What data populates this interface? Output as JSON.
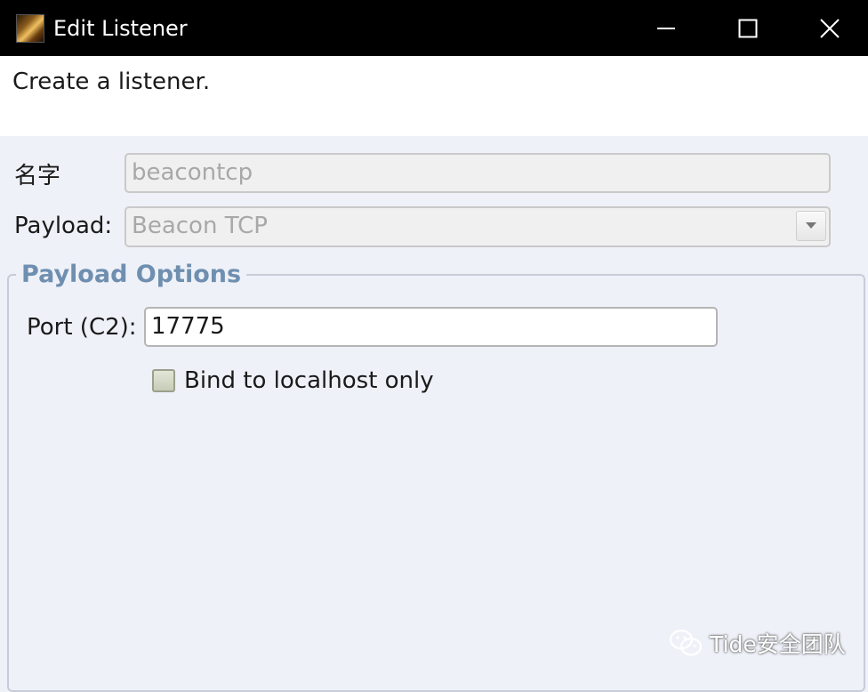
{
  "window": {
    "title": "Edit Listener",
    "icon": "app-icon",
    "controls": [
      "minimize-icon",
      "maximize-icon",
      "close-icon"
    ]
  },
  "header": {
    "description": "Create a listener."
  },
  "form": {
    "name_label": "名字",
    "name_value": "beacontcp",
    "payload_label": "Payload:",
    "payload_value": "Beacon TCP"
  },
  "payload_options": {
    "title": "Payload Options",
    "port_label": "Port (C2):",
    "port_value": "17775",
    "bind_localhost_label": "Bind to localhost only",
    "bind_localhost_checked": false
  },
  "watermark": {
    "icon": "wechat-icon",
    "text": "Tide安全团队"
  },
  "colors": {
    "titlebar": "#000000",
    "header_bg": "#ffffff",
    "dialog_bg": "#eef1f8",
    "group_title": "#6f8fb0",
    "disabled_text": "#a8a8a8"
  }
}
